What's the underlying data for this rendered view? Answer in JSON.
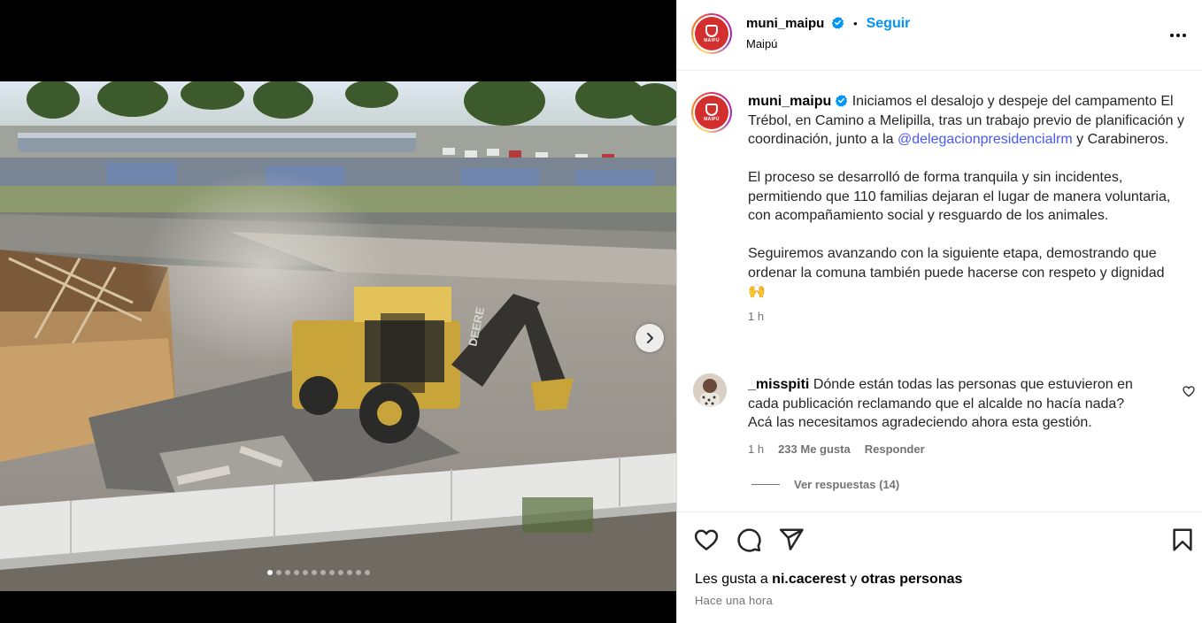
{
  "post": {
    "username": "muni_maipu",
    "follow_label": "Seguir",
    "separator": "•",
    "location": "Maipú",
    "avatar_text": "MAIPÚ",
    "brand_color": "#d32f2f",
    "link_color": "#4a5af0",
    "follow_color": "#0095f6",
    "more_icon": "more-horizontal-icon",
    "verified_icon": "verified-badge-icon"
  },
  "caption": {
    "username": "muni_maipu",
    "p1_a": "Iniciamos el desalojo y despeje del campamento El Trébol, en Camino a Melipilla, tras un trabajo previo de planificación y coordinación, junto a la ",
    "mention": "@delegacionpresidencialrm",
    "p1_b": " y Carabineros.",
    "p2": "El proceso se desarrolló de forma tranquila y sin incidentes, permitiendo que 110 familias dejaran el lugar de manera voluntaria, con acompañamiento social y resguardo de los animales.",
    "p3": "Seguiremos avanzando con la siguiente etapa, demostrando que ordenar la comuna también puede hacerse con respeto y dignidad",
    "emoji": "🙌",
    "time": "1 h"
  },
  "comment": {
    "username": "_misspiti",
    "text": "Dónde están todas las personas que estuvieron en cada publicación reclamando que el alcalde no hacía nada? Acá las necesitamos agradeciendo ahora esta gestión.",
    "time": "1 h",
    "likes": "233 Me gusta",
    "reply_label": "Responder",
    "view_replies": "Ver respuestas (14)"
  },
  "actions": {
    "icons": [
      "heart-icon",
      "comment-icon",
      "share-icon",
      "bookmark-icon"
    ],
    "likes_prefix": "Les gusta a ",
    "likes_user": "ni.cacerest",
    "likes_mid": " y ",
    "likes_others": "otras personas",
    "posted": "Hace una hora"
  },
  "media": {
    "carousel_total": 12,
    "carousel_index": 1,
    "next_icon": "chevron-right-icon",
    "machine_label": "DEERE"
  }
}
